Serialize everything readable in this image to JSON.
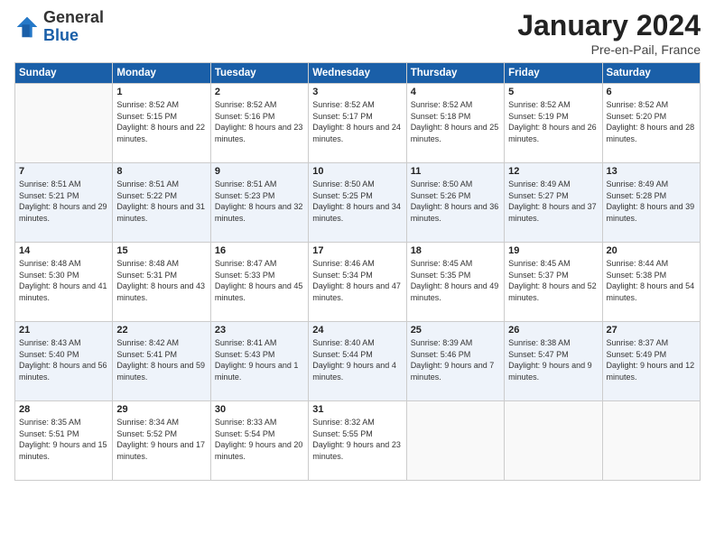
{
  "header": {
    "logo": {
      "general": "General",
      "blue": "Blue"
    },
    "month": "January 2024",
    "location": "Pre-en-Pail, France"
  },
  "weekdays": [
    "Sunday",
    "Monday",
    "Tuesday",
    "Wednesday",
    "Thursday",
    "Friday",
    "Saturday"
  ],
  "weeks": [
    [
      {
        "day": "",
        "sunrise": "",
        "sunset": "",
        "daylight": ""
      },
      {
        "day": "1",
        "sunrise": "Sunrise: 8:52 AM",
        "sunset": "Sunset: 5:15 PM",
        "daylight": "Daylight: 8 hours and 22 minutes."
      },
      {
        "day": "2",
        "sunrise": "Sunrise: 8:52 AM",
        "sunset": "Sunset: 5:16 PM",
        "daylight": "Daylight: 8 hours and 23 minutes."
      },
      {
        "day": "3",
        "sunrise": "Sunrise: 8:52 AM",
        "sunset": "Sunset: 5:17 PM",
        "daylight": "Daylight: 8 hours and 24 minutes."
      },
      {
        "day": "4",
        "sunrise": "Sunrise: 8:52 AM",
        "sunset": "Sunset: 5:18 PM",
        "daylight": "Daylight: 8 hours and 25 minutes."
      },
      {
        "day": "5",
        "sunrise": "Sunrise: 8:52 AM",
        "sunset": "Sunset: 5:19 PM",
        "daylight": "Daylight: 8 hours and 26 minutes."
      },
      {
        "day": "6",
        "sunrise": "Sunrise: 8:52 AM",
        "sunset": "Sunset: 5:20 PM",
        "daylight": "Daylight: 8 hours and 28 minutes."
      }
    ],
    [
      {
        "day": "7",
        "sunrise": "Sunrise: 8:51 AM",
        "sunset": "Sunset: 5:21 PM",
        "daylight": "Daylight: 8 hours and 29 minutes."
      },
      {
        "day": "8",
        "sunrise": "Sunrise: 8:51 AM",
        "sunset": "Sunset: 5:22 PM",
        "daylight": "Daylight: 8 hours and 31 minutes."
      },
      {
        "day": "9",
        "sunrise": "Sunrise: 8:51 AM",
        "sunset": "Sunset: 5:23 PM",
        "daylight": "Daylight: 8 hours and 32 minutes."
      },
      {
        "day": "10",
        "sunrise": "Sunrise: 8:50 AM",
        "sunset": "Sunset: 5:25 PM",
        "daylight": "Daylight: 8 hours and 34 minutes."
      },
      {
        "day": "11",
        "sunrise": "Sunrise: 8:50 AM",
        "sunset": "Sunset: 5:26 PM",
        "daylight": "Daylight: 8 hours and 36 minutes."
      },
      {
        "day": "12",
        "sunrise": "Sunrise: 8:49 AM",
        "sunset": "Sunset: 5:27 PM",
        "daylight": "Daylight: 8 hours and 37 minutes."
      },
      {
        "day": "13",
        "sunrise": "Sunrise: 8:49 AM",
        "sunset": "Sunset: 5:28 PM",
        "daylight": "Daylight: 8 hours and 39 minutes."
      }
    ],
    [
      {
        "day": "14",
        "sunrise": "Sunrise: 8:48 AM",
        "sunset": "Sunset: 5:30 PM",
        "daylight": "Daylight: 8 hours and 41 minutes."
      },
      {
        "day": "15",
        "sunrise": "Sunrise: 8:48 AM",
        "sunset": "Sunset: 5:31 PM",
        "daylight": "Daylight: 8 hours and 43 minutes."
      },
      {
        "day": "16",
        "sunrise": "Sunrise: 8:47 AM",
        "sunset": "Sunset: 5:33 PM",
        "daylight": "Daylight: 8 hours and 45 minutes."
      },
      {
        "day": "17",
        "sunrise": "Sunrise: 8:46 AM",
        "sunset": "Sunset: 5:34 PM",
        "daylight": "Daylight: 8 hours and 47 minutes."
      },
      {
        "day": "18",
        "sunrise": "Sunrise: 8:45 AM",
        "sunset": "Sunset: 5:35 PM",
        "daylight": "Daylight: 8 hours and 49 minutes."
      },
      {
        "day": "19",
        "sunrise": "Sunrise: 8:45 AM",
        "sunset": "Sunset: 5:37 PM",
        "daylight": "Daylight: 8 hours and 52 minutes."
      },
      {
        "day": "20",
        "sunrise": "Sunrise: 8:44 AM",
        "sunset": "Sunset: 5:38 PM",
        "daylight": "Daylight: 8 hours and 54 minutes."
      }
    ],
    [
      {
        "day": "21",
        "sunrise": "Sunrise: 8:43 AM",
        "sunset": "Sunset: 5:40 PM",
        "daylight": "Daylight: 8 hours and 56 minutes."
      },
      {
        "day": "22",
        "sunrise": "Sunrise: 8:42 AM",
        "sunset": "Sunset: 5:41 PM",
        "daylight": "Daylight: 8 hours and 59 minutes."
      },
      {
        "day": "23",
        "sunrise": "Sunrise: 8:41 AM",
        "sunset": "Sunset: 5:43 PM",
        "daylight": "Daylight: 9 hours and 1 minute."
      },
      {
        "day": "24",
        "sunrise": "Sunrise: 8:40 AM",
        "sunset": "Sunset: 5:44 PM",
        "daylight": "Daylight: 9 hours and 4 minutes."
      },
      {
        "day": "25",
        "sunrise": "Sunrise: 8:39 AM",
        "sunset": "Sunset: 5:46 PM",
        "daylight": "Daylight: 9 hours and 7 minutes."
      },
      {
        "day": "26",
        "sunrise": "Sunrise: 8:38 AM",
        "sunset": "Sunset: 5:47 PM",
        "daylight": "Daylight: 9 hours and 9 minutes."
      },
      {
        "day": "27",
        "sunrise": "Sunrise: 8:37 AM",
        "sunset": "Sunset: 5:49 PM",
        "daylight": "Daylight: 9 hours and 12 minutes."
      }
    ],
    [
      {
        "day": "28",
        "sunrise": "Sunrise: 8:35 AM",
        "sunset": "Sunset: 5:51 PM",
        "daylight": "Daylight: 9 hours and 15 minutes."
      },
      {
        "day": "29",
        "sunrise": "Sunrise: 8:34 AM",
        "sunset": "Sunset: 5:52 PM",
        "daylight": "Daylight: 9 hours and 17 minutes."
      },
      {
        "day": "30",
        "sunrise": "Sunrise: 8:33 AM",
        "sunset": "Sunset: 5:54 PM",
        "daylight": "Daylight: 9 hours and 20 minutes."
      },
      {
        "day": "31",
        "sunrise": "Sunrise: 8:32 AM",
        "sunset": "Sunset: 5:55 PM",
        "daylight": "Daylight: 9 hours and 23 minutes."
      },
      {
        "day": "",
        "sunrise": "",
        "sunset": "",
        "daylight": ""
      },
      {
        "day": "",
        "sunrise": "",
        "sunset": "",
        "daylight": ""
      },
      {
        "day": "",
        "sunrise": "",
        "sunset": "",
        "daylight": ""
      }
    ]
  ]
}
